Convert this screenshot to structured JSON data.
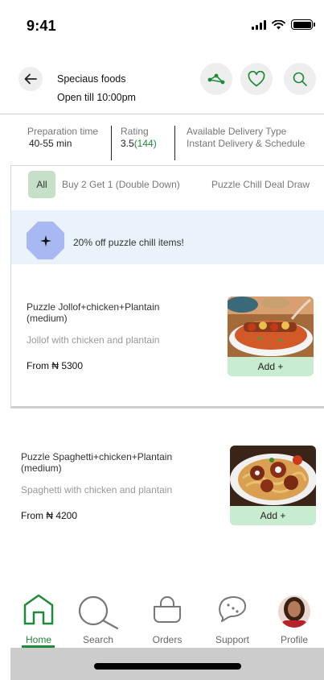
{
  "status_bar": {
    "time": "9:41"
  },
  "header": {
    "store_name": "Speciaus foods",
    "hours": "Open till 10:00pm"
  },
  "icons": {
    "back": "arrow-left-icon",
    "share": "share-icon",
    "favorite": "heart-icon",
    "search": "search-icon"
  },
  "info": {
    "prep_label": "Preparation time",
    "prep_value": "40-55 min",
    "rating_label": "Rating",
    "rating_value": "3.5",
    "rating_count": "(144)",
    "delivery_label": "Available Delivery Type",
    "delivery_value": "Instant Delivery & Schedule"
  },
  "tabs": [
    "All",
    "Buy 2 Get 1 (Double Down)",
    "Puzzle Chill Deal Draw"
  ],
  "deal": {
    "text": "20% off puzzle chill items!"
  },
  "items": [
    {
      "name": "Puzzle Jollof+chicken+Plantain (medium)",
      "description": "Jollof with  chicken and plantain",
      "price": "From ₦ 5300",
      "add_label": "Add +"
    },
    {
      "name": "Puzzle Spaghetti+chicken+Plantain (medium)",
      "description": "Spaghetti with  chicken and plantain",
      "price": "From ₦ 4200",
      "add_label": "Add +"
    }
  ],
  "nav": [
    {
      "label": "Home",
      "icon": "home-icon",
      "active": true
    },
    {
      "label": "Search",
      "icon": "search-icon"
    },
    {
      "label": "Orders",
      "icon": "basket-icon"
    },
    {
      "label": "Support",
      "icon": "chat-bubble-icon"
    },
    {
      "label": "Profile",
      "icon": "avatar"
    }
  ],
  "colors": {
    "accent": "#1f8a3a",
    "tab_active_bg": "#c5e0c6",
    "add_button_bg": "#c8ecd0",
    "deal_banner_bg": "#eaf2fb",
    "deal_badge": "#a8b8f3"
  }
}
